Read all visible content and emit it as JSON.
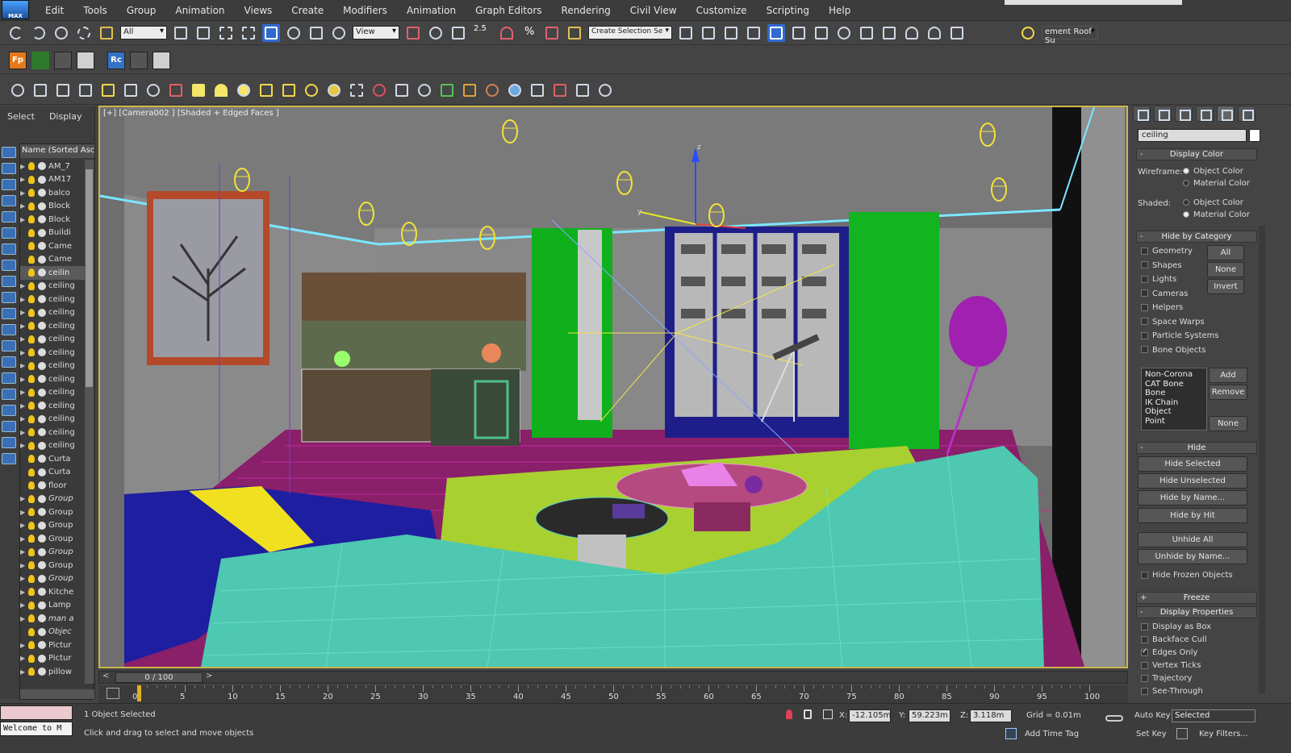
{
  "app": {
    "logo_text": "MAX"
  },
  "menu": [
    "Edit",
    "Tools",
    "Group",
    "Animation",
    "Views",
    "Create",
    "Modifiers",
    "Animation",
    "Graph Editors",
    "Rendering",
    "Civil View",
    "Customize",
    "Scripting",
    "Help"
  ],
  "toolbar": {
    "selection_filter": "All",
    "ref_coord": "View",
    "snap_value": "2.5",
    "named_selection": "Create Selection Se",
    "workspace_label": "ement Roof Su"
  },
  "toolbar2": {
    "fp_label": "Fp",
    "rc_label": "Rc"
  },
  "left_panel": {
    "tabs": [
      "Select",
      "Display"
    ],
    "header": "Name (Sorted Ascer",
    "items": [
      {
        "name": "AM_7",
        "expand": true,
        "style": "normal"
      },
      {
        "name": "AM17",
        "expand": true,
        "style": "normal"
      },
      {
        "name": "balco",
        "expand": true,
        "style": "normal"
      },
      {
        "name": "Block",
        "expand": true,
        "style": "normal"
      },
      {
        "name": "Block",
        "expand": true,
        "style": "normal"
      },
      {
        "name": "Buildi",
        "expand": false,
        "style": "normal"
      },
      {
        "name": "Came",
        "expand": false,
        "style": "normal"
      },
      {
        "name": "Came",
        "expand": false,
        "style": "normal"
      },
      {
        "name": "ceilin",
        "expand": false,
        "style": "selected"
      },
      {
        "name": "ceiling",
        "expand": true,
        "style": "normal"
      },
      {
        "name": "ceiling",
        "expand": true,
        "style": "normal"
      },
      {
        "name": "ceiling",
        "expand": true,
        "style": "normal"
      },
      {
        "name": "ceiling",
        "expand": true,
        "style": "normal"
      },
      {
        "name": "ceiling",
        "expand": true,
        "style": "normal"
      },
      {
        "name": "ceiling",
        "expand": true,
        "style": "normal"
      },
      {
        "name": "ceiling",
        "expand": true,
        "style": "normal"
      },
      {
        "name": "ceiling",
        "expand": true,
        "style": "normal"
      },
      {
        "name": "ceiling",
        "expand": true,
        "style": "normal"
      },
      {
        "name": "ceiling",
        "expand": true,
        "style": "normal"
      },
      {
        "name": "ceiling",
        "expand": true,
        "style": "normal"
      },
      {
        "name": "ceiling",
        "expand": true,
        "style": "normal"
      },
      {
        "name": "ceiling",
        "expand": true,
        "style": "normal"
      },
      {
        "name": "Curta",
        "expand": false,
        "style": "normal"
      },
      {
        "name": "Curta",
        "expand": false,
        "style": "normal"
      },
      {
        "name": "floor",
        "expand": false,
        "style": "normal"
      },
      {
        "name": "Group",
        "expand": true,
        "style": "italic"
      },
      {
        "name": "Group",
        "expand": true,
        "style": "normal"
      },
      {
        "name": "Group",
        "expand": true,
        "style": "normal"
      },
      {
        "name": "Group",
        "expand": true,
        "style": "normal"
      },
      {
        "name": "Group",
        "expand": true,
        "style": "italic"
      },
      {
        "name": "Group",
        "expand": true,
        "style": "normal"
      },
      {
        "name": "Group",
        "expand": true,
        "style": "italic"
      },
      {
        "name": "Kitche",
        "expand": true,
        "style": "normal"
      },
      {
        "name": "Lamp",
        "expand": true,
        "style": "normal"
      },
      {
        "name": "man a",
        "expand": true,
        "style": "italic"
      },
      {
        "name": "Objec",
        "expand": false,
        "style": "italic"
      },
      {
        "name": "Pictur",
        "expand": true,
        "style": "normal"
      },
      {
        "name": "Pictur",
        "expand": true,
        "style": "normal"
      },
      {
        "name": "pillow",
        "expand": true,
        "style": "normal"
      }
    ]
  },
  "viewport": {
    "label": "[+] [Camera002 ] [Shaded + Edged Faces ]",
    "axis_x": "x",
    "axis_y": "y",
    "axis_z": "z"
  },
  "right_panel": {
    "filter": "ceiling",
    "display_color": {
      "title": "Display Color",
      "wireframe_label": "Wireframe:",
      "shaded_label": "Shaded:",
      "object_color": "Object Color",
      "material_color": "Material Color"
    },
    "hide_by_category": {
      "title": "Hide by Category",
      "items": [
        "Geometry",
        "Shapes",
        "Lights",
        "Cameras",
        "Helpers",
        "Space Warps",
        "Particle Systems",
        "Bone Objects"
      ],
      "buttons": [
        "All",
        "None",
        "Invert"
      ],
      "list": [
        "Non-Corona",
        "CAT Bone",
        "Bone",
        "IK Chain Object",
        "Point"
      ],
      "list_buttons": [
        "Add",
        "Remove",
        "None"
      ]
    },
    "hide": {
      "title": "Hide",
      "buttons": [
        "Hide Selected",
        "Hide Unselected",
        "Hide by Name...",
        "Hide by Hit",
        "Unhide All",
        "Unhide by Name..."
      ],
      "hide_frozen": "Hide Frozen Objects"
    },
    "freeze": {
      "title": "Freeze"
    },
    "display_properties": {
      "title": "Display Properties",
      "items": [
        {
          "label": "Display as Box",
          "checked": false
        },
        {
          "label": "Backface Cull",
          "checked": false
        },
        {
          "label": "Edges Only",
          "checked": true
        },
        {
          "label": "Vertex Ticks",
          "checked": false
        },
        {
          "label": "Trajectory",
          "checked": false
        },
        {
          "label": "See-Through",
          "checked": false
        }
      ]
    }
  },
  "timeline": {
    "slider": "0 / 100",
    "ticks": [
      "0",
      "5",
      "10",
      "15",
      "20",
      "25",
      "30",
      "35",
      "40",
      "45",
      "50",
      "55",
      "60",
      "65",
      "70",
      "75",
      "80",
      "85",
      "90",
      "95",
      "100"
    ]
  },
  "status": {
    "welcome": "Welcome to M",
    "selected": "1 Object Selected",
    "prompt": "Click and drag to select and move objects",
    "x_label": "X:",
    "x": "-12.105m",
    "y_label": "Y:",
    "y": "59.223m",
    "z_label": "Z:",
    "z": "3.118m",
    "grid": "Grid = 0.01m",
    "auto_key": "Auto Key",
    "set_key": "Set Key",
    "key_mode": "Selected",
    "key_filters": "Key Filters...",
    "add_time_tag": "Add Time Tag"
  }
}
